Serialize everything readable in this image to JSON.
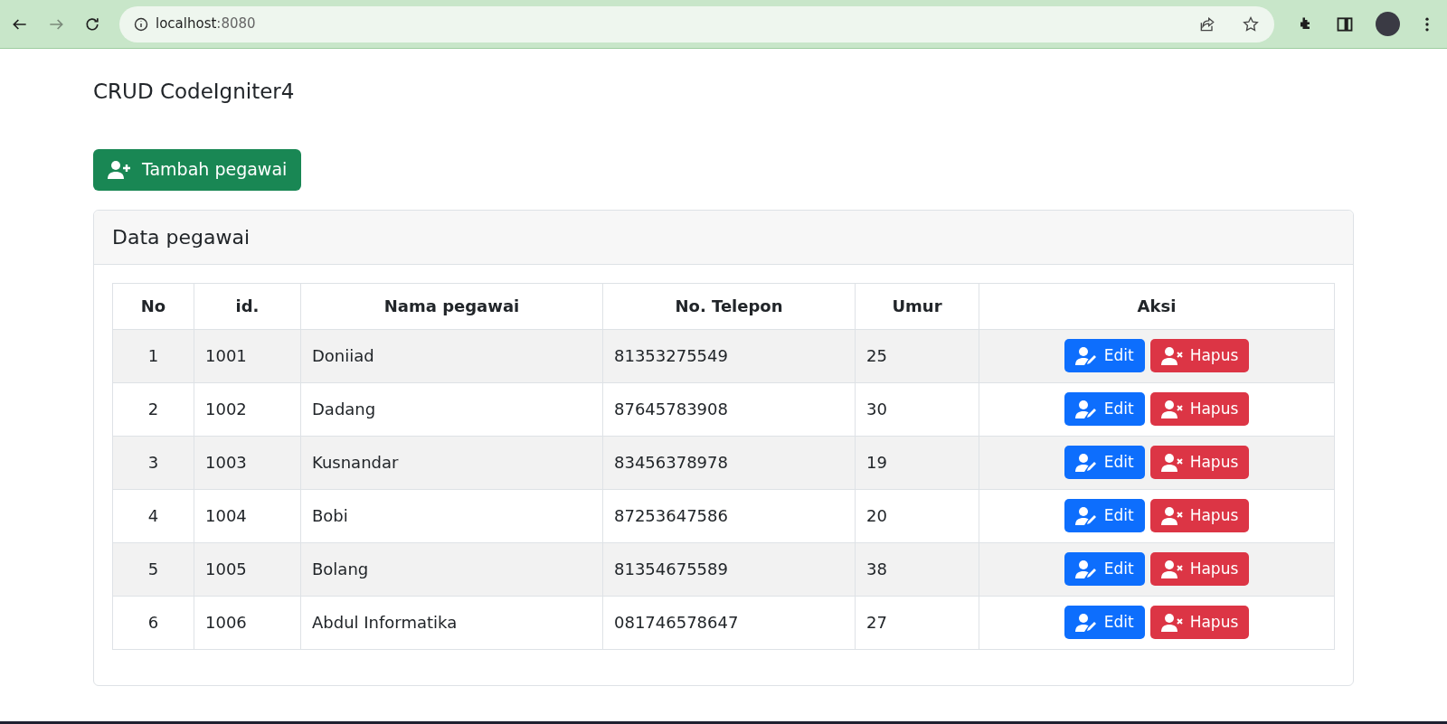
{
  "browser": {
    "url_host": "localhost",
    "url_port": ":8080"
  },
  "page": {
    "title": "CRUD CodeIgniter4",
    "add_button": "Tambah pegawai"
  },
  "card": {
    "title": "Data pegawai"
  },
  "table": {
    "columns": [
      "No",
      "id.",
      "Nama pegawai",
      "No. Telepon",
      "Umur",
      "Aksi"
    ],
    "rows": [
      {
        "no": "1",
        "id": "1001",
        "name": "Doniiad",
        "phone": "81353275549",
        "age": "25",
        "edit": "Edit",
        "delete": "Hapus"
      },
      {
        "no": "2",
        "id": "1002",
        "name": "Dadang",
        "phone": "87645783908",
        "age": "30",
        "edit": "Edit",
        "delete": "Hapus"
      },
      {
        "no": "3",
        "id": "1003",
        "name": "Kusnandar",
        "phone": "83456378978",
        "age": "19",
        "edit": "Edit",
        "delete": "Hapus"
      },
      {
        "no": "4",
        "id": "1004",
        "name": "Bobi",
        "phone": "87253647586",
        "age": "20",
        "edit": "Edit",
        "delete": "Hapus"
      },
      {
        "no": "5",
        "id": "1005",
        "name": "Bolang",
        "phone": "81354675589",
        "age": "38",
        "edit": "Edit",
        "delete": "Hapus"
      },
      {
        "no": "6",
        "id": "1006",
        "name": "Abdul Informatika",
        "phone": "081746578647",
        "age": "27",
        "edit": "Edit",
        "delete": "Hapus"
      }
    ]
  }
}
